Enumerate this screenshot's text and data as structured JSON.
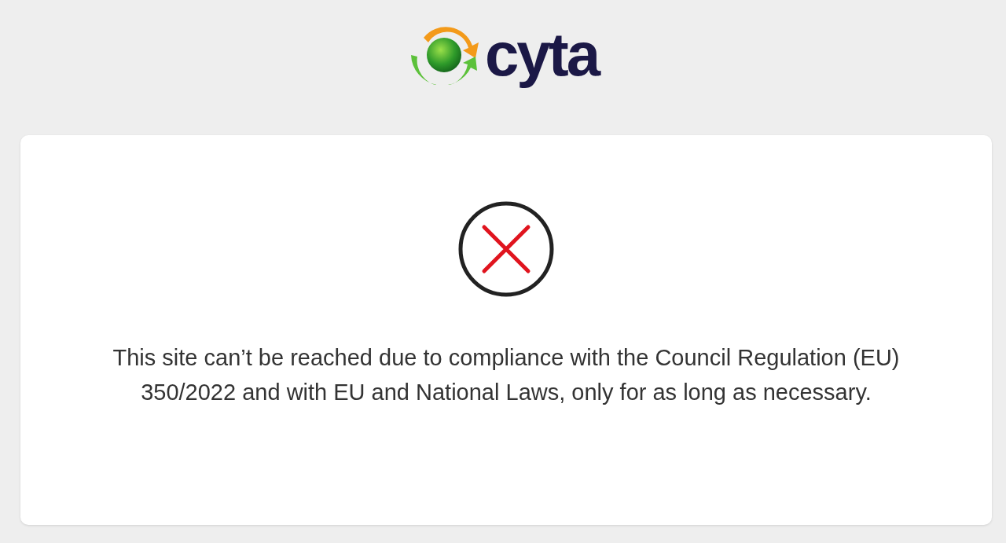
{
  "logo": {
    "text": "cyta"
  },
  "message": {
    "kind": "error",
    "text": "This site can’t be reached due to compliance with the Council Regulation (EU) 350/2022 and with EU and National Laws, only for as long as necessary."
  }
}
